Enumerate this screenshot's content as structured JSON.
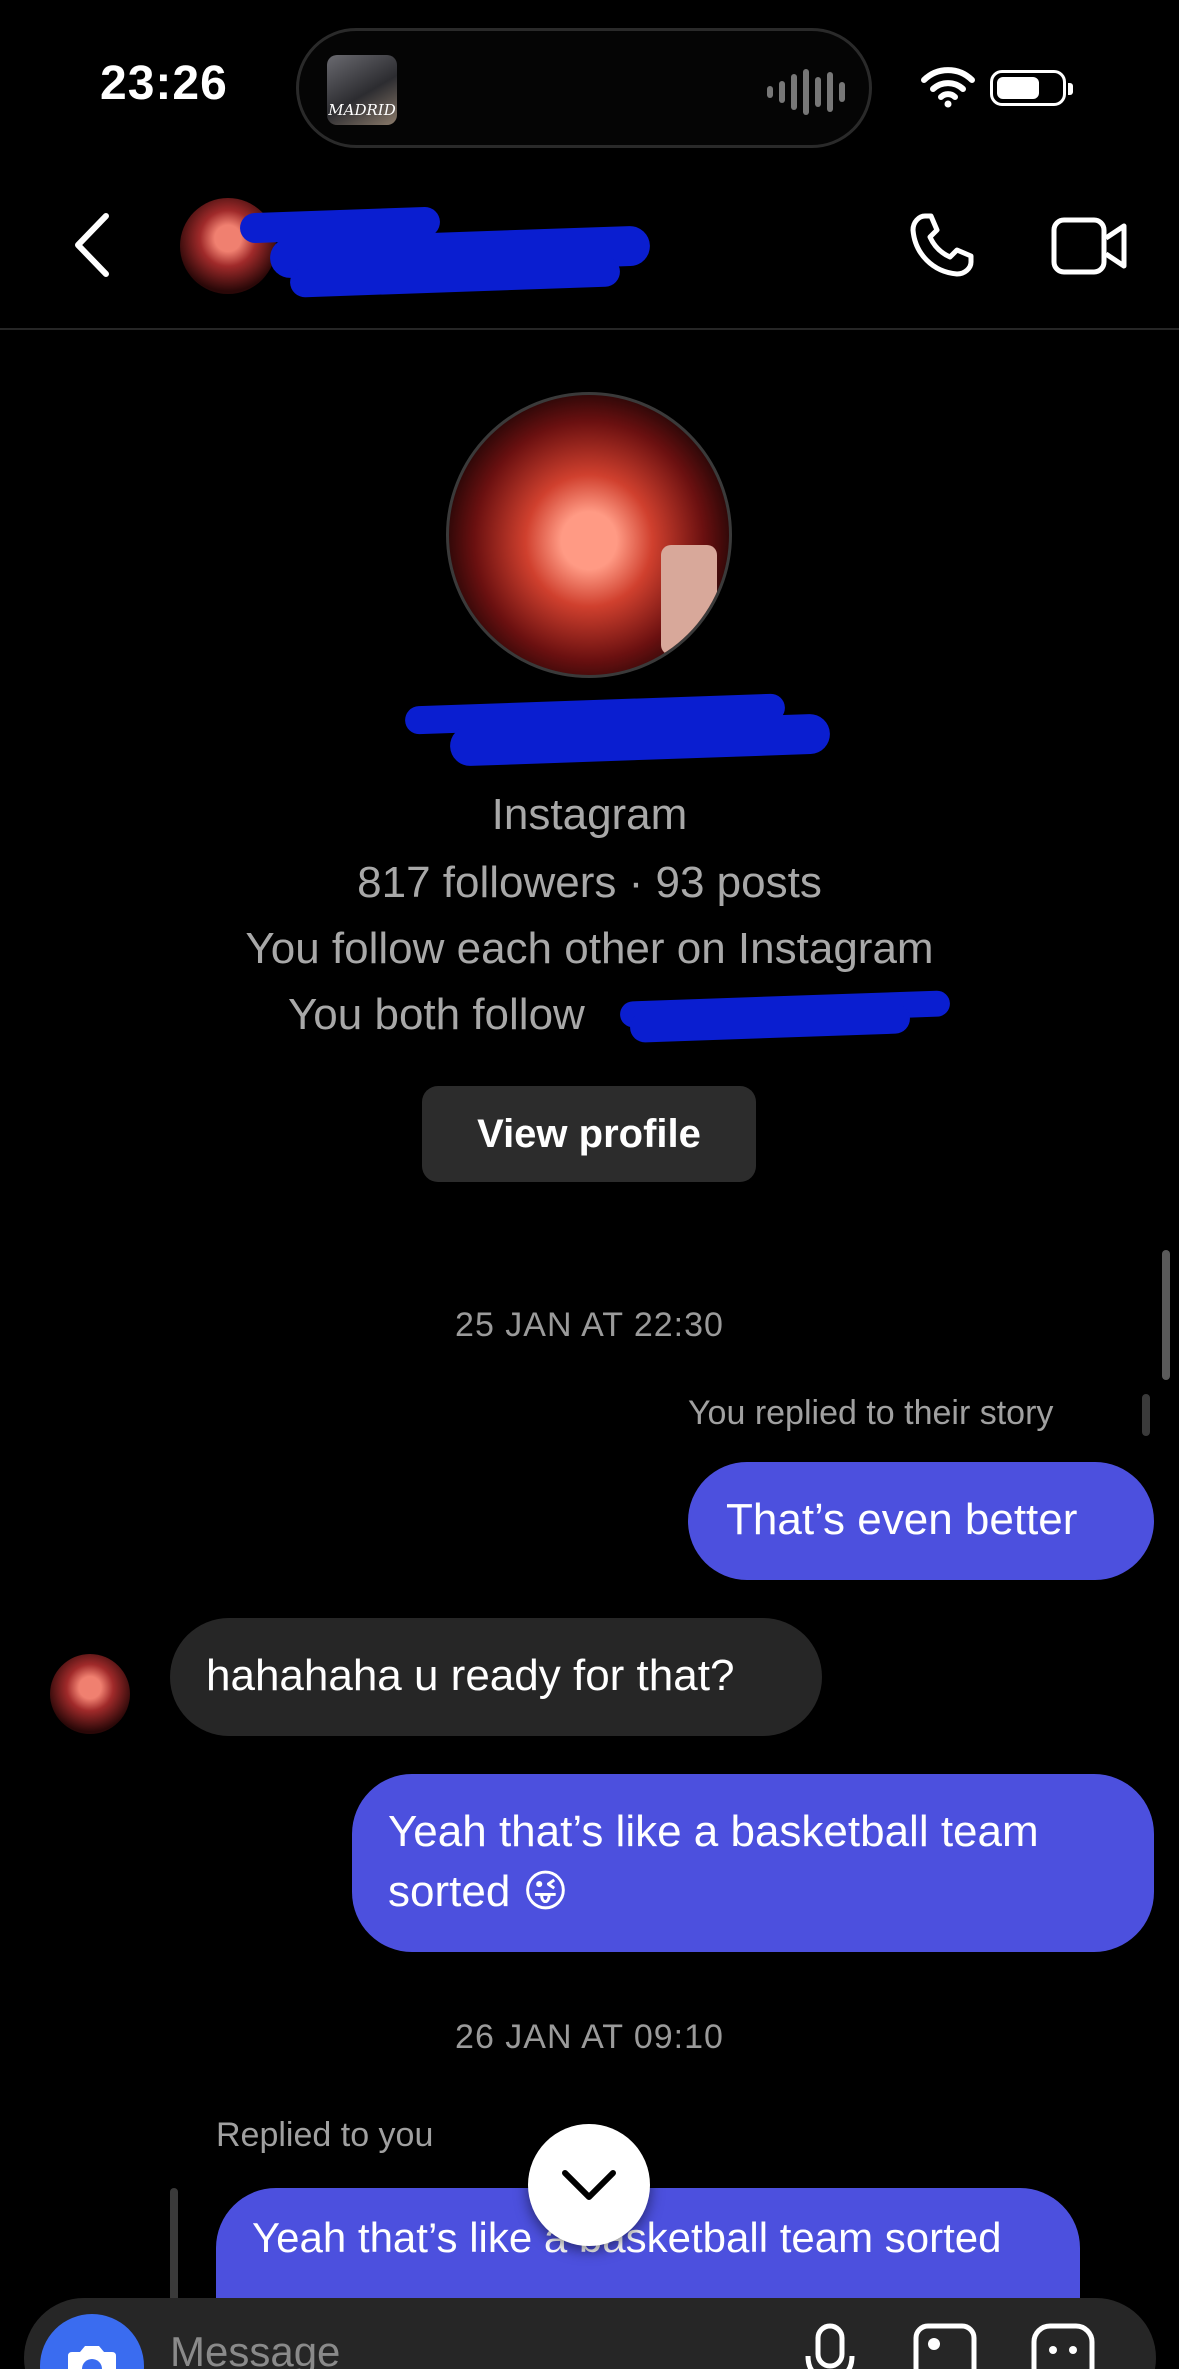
{
  "status_bar": {
    "time": "23:26",
    "now_playing_art_text": "MADRID"
  },
  "header": {
    "back_icon": "chevron-left-icon",
    "call_icon": "phone-icon",
    "video_icon": "video-camera-icon"
  },
  "profile": {
    "platform": "Instagram",
    "stats": "817 followers · 93 posts",
    "relationship": "You follow each other on Instagram",
    "mutual": "You both follow",
    "view_profile_label": "View profile"
  },
  "thread": {
    "timestamp_1": "25 JAN AT 22:30",
    "story_reply_note": "You replied to their story",
    "msg_1": "That’s even better",
    "msg_2": "hahahaha u ready for that?",
    "msg_3_line1": "Yeah that’s like a basketball team",
    "msg_3_line2": "sorted 😜",
    "timestamp_2": "26 JAN AT 09:10",
    "reply_note": "Replied to you",
    "quoted_reply": "Yeah that’s like a basketball team sorted"
  },
  "composer": {
    "placeholder": "Message"
  },
  "colors": {
    "sent_bubble": "#4c50de",
    "received_bubble": "#262626",
    "camera_button": "#3a6cf0",
    "redaction": "#0a1ed0"
  }
}
